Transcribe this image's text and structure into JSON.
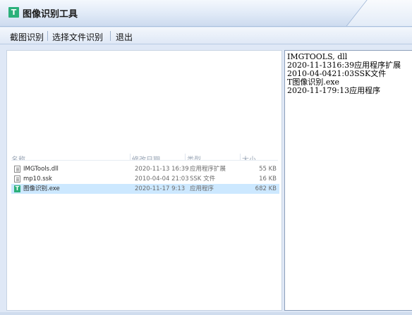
{
  "window": {
    "title": "图像识别工具",
    "icon_letter": "T"
  },
  "menu": {
    "items": [
      "截图识别",
      "选择文件识别",
      "退出"
    ]
  },
  "file_list": {
    "headers": [
      "名称",
      "修改日期",
      "类型",
      "大小"
    ],
    "rows": [
      {
        "name": "IMGTools.dll",
        "date": "2020-11-13 16:39",
        "type": "应用程序扩展",
        "size": "55 KB",
        "icon": "dll-file-icon"
      },
      {
        "name": "mp10.ssk",
        "date": "2010-04-04 21:03",
        "type": "SSK 文件",
        "size": "16 KB",
        "icon": "generic-file-icon"
      },
      {
        "name": "图像识别.exe",
        "date": "2020-11-17 9:13",
        "type": "应用程序",
        "size": "682 KB",
        "icon": "app-exe-icon",
        "selected": true
      }
    ]
  },
  "result_text": {
    "lines": [
      "IMGTOOLS, dll",
      "2020-11-1316:39应用程序扩展",
      "2010-04-0421:03SSK文件",
      "T图像识别.exe",
      "2020-11-179:13应用程序"
    ]
  },
  "colors": {
    "accent": "#2bb07a",
    "selection": "#cce8ff",
    "chrome": "#dfe8f6"
  }
}
